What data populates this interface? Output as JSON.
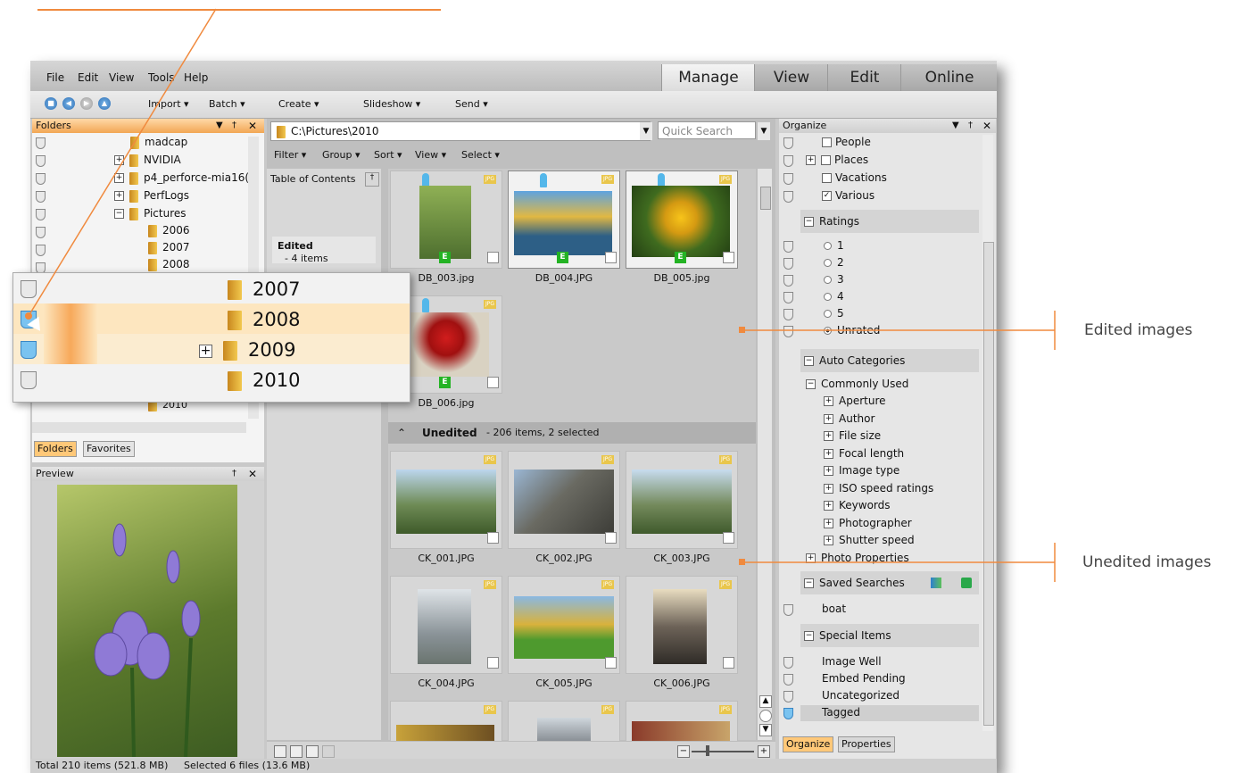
{
  "menu": [
    "File",
    "Edit",
    "View",
    "Tools",
    "Help"
  ],
  "modes": [
    "Manage",
    "View",
    "Edit",
    "Online"
  ],
  "toolbar": {
    "nav": [
      "◀",
      "▶"
    ],
    "items": [
      "Import",
      "Batch",
      "Create",
      "Slideshow",
      "Send"
    ]
  },
  "folders_panel": {
    "title": "Folders",
    "tree": [
      "madcap",
      "NVIDIA",
      "p4_perforce-mia16(",
      "PerfLogs",
      "Pictures",
      "2006",
      "2007",
      "2008"
    ],
    "partial_bottom": "2010",
    "tabs": [
      "Folders",
      "Favorites"
    ]
  },
  "preview_panel": {
    "title": "Preview"
  },
  "zoom_callout": {
    "items": [
      "2007",
      "2008",
      "2009",
      "2010"
    ]
  },
  "address": {
    "path": "C:\\Pictures\\2010",
    "search_placeholder": "Quick Search"
  },
  "filterbar": [
    "Filter",
    "Group",
    "Sort",
    "View",
    "Select"
  ],
  "toc": {
    "title": "Table of Contents",
    "edited_label": "Edited",
    "edited_count": "- 4 items"
  },
  "edited_thumbs": [
    "DB_003.jpg",
    "DB_004.JPG",
    "DB_005.jpg",
    "DB_006.jpg"
  ],
  "unedited_group": {
    "label": "Unedited",
    "count": "- 206 items, 2 selected"
  },
  "unedited_thumbs": [
    "CK_001.JPG",
    "CK_002.JPG",
    "CK_003.JPG",
    "CK_004.JPG",
    "CK_005.JPG",
    "CK_006.JPG"
  ],
  "organize": {
    "title": "Organize",
    "categories": [
      {
        "label": "People",
        "checked": false
      },
      {
        "label": "Places",
        "checked": false
      },
      {
        "label": "Vacations",
        "checked": false
      },
      {
        "label": "Various",
        "checked": true
      }
    ],
    "ratings_header": "Ratings",
    "ratings": [
      "1",
      "2",
      "3",
      "4",
      "5",
      "Unrated"
    ],
    "auto_header": "Auto Categories",
    "commonly_used": "Commonly Used",
    "auto_items": [
      "Aperture",
      "Author",
      "File size",
      "Focal length",
      "Image type",
      "ISO speed ratings",
      "Keywords",
      "Photographer",
      "Shutter speed"
    ],
    "photo_properties": "Photo Properties",
    "saved_header": "Saved Searches",
    "saved": [
      "boat"
    ],
    "special_header": "Special Items",
    "special": [
      "Image Well",
      "Embed Pending",
      "Uncategorized",
      "Tagged"
    ],
    "tabs": [
      "Organize",
      "Properties"
    ]
  },
  "status": {
    "total": "Total 210 items (521.8 MB)",
    "selected": "Selected 6 files (13.6 MB)"
  },
  "callouts": {
    "edited": "Edited images",
    "unedited": "Unedited images"
  },
  "colors": {
    "accent_orange": "#f08a3e",
    "edited_badge": "#24b324",
    "tag_blue": "#54b7ea"
  }
}
